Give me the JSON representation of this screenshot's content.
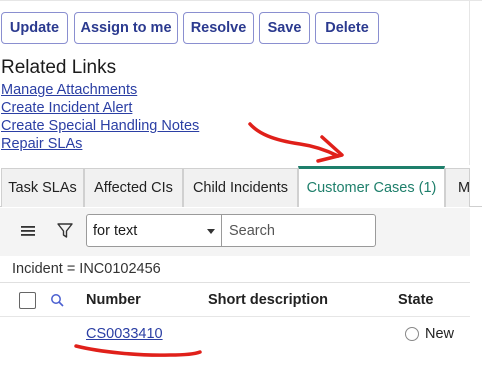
{
  "buttons": {
    "update": "Update",
    "assign_to_me": "Assign to me",
    "resolve": "Resolve",
    "save": "Save",
    "delete": "Delete"
  },
  "related_links": {
    "title": "Related Links",
    "links": [
      "Manage Attachments",
      "Create Incident Alert",
      "Create Special Handling Notes",
      "Repair SLAs"
    ]
  },
  "tabs": [
    {
      "label": "Task SLAs",
      "active": false
    },
    {
      "label": "Affected CIs",
      "active": false
    },
    {
      "label": "Child Incidents",
      "active": false
    },
    {
      "label": "Customer Cases (1)",
      "active": true
    },
    {
      "label": "Mu",
      "active": false
    }
  ],
  "list": {
    "filter_select_value": "for text",
    "search_placeholder": "Search",
    "breadcrumb": "Incident = INC0102456",
    "columns": {
      "number": "Number",
      "short_description": "Short description",
      "state": "State"
    },
    "rows": [
      {
        "number": "CS0033410",
        "short_description": "",
        "state": "New"
      }
    ]
  },
  "icons": {
    "menu": "hamburger-menu-icon",
    "filter": "funnel-filter-icon",
    "search_columns": "magnifier-icon",
    "caret": "caret-down-icon"
  },
  "colors": {
    "button_border": "#8a8fd0",
    "button_text": "#2b3a8f",
    "link": "#2b3fa4",
    "active_tab": "#1e7f6b",
    "annotation_red": "#e0201a"
  }
}
